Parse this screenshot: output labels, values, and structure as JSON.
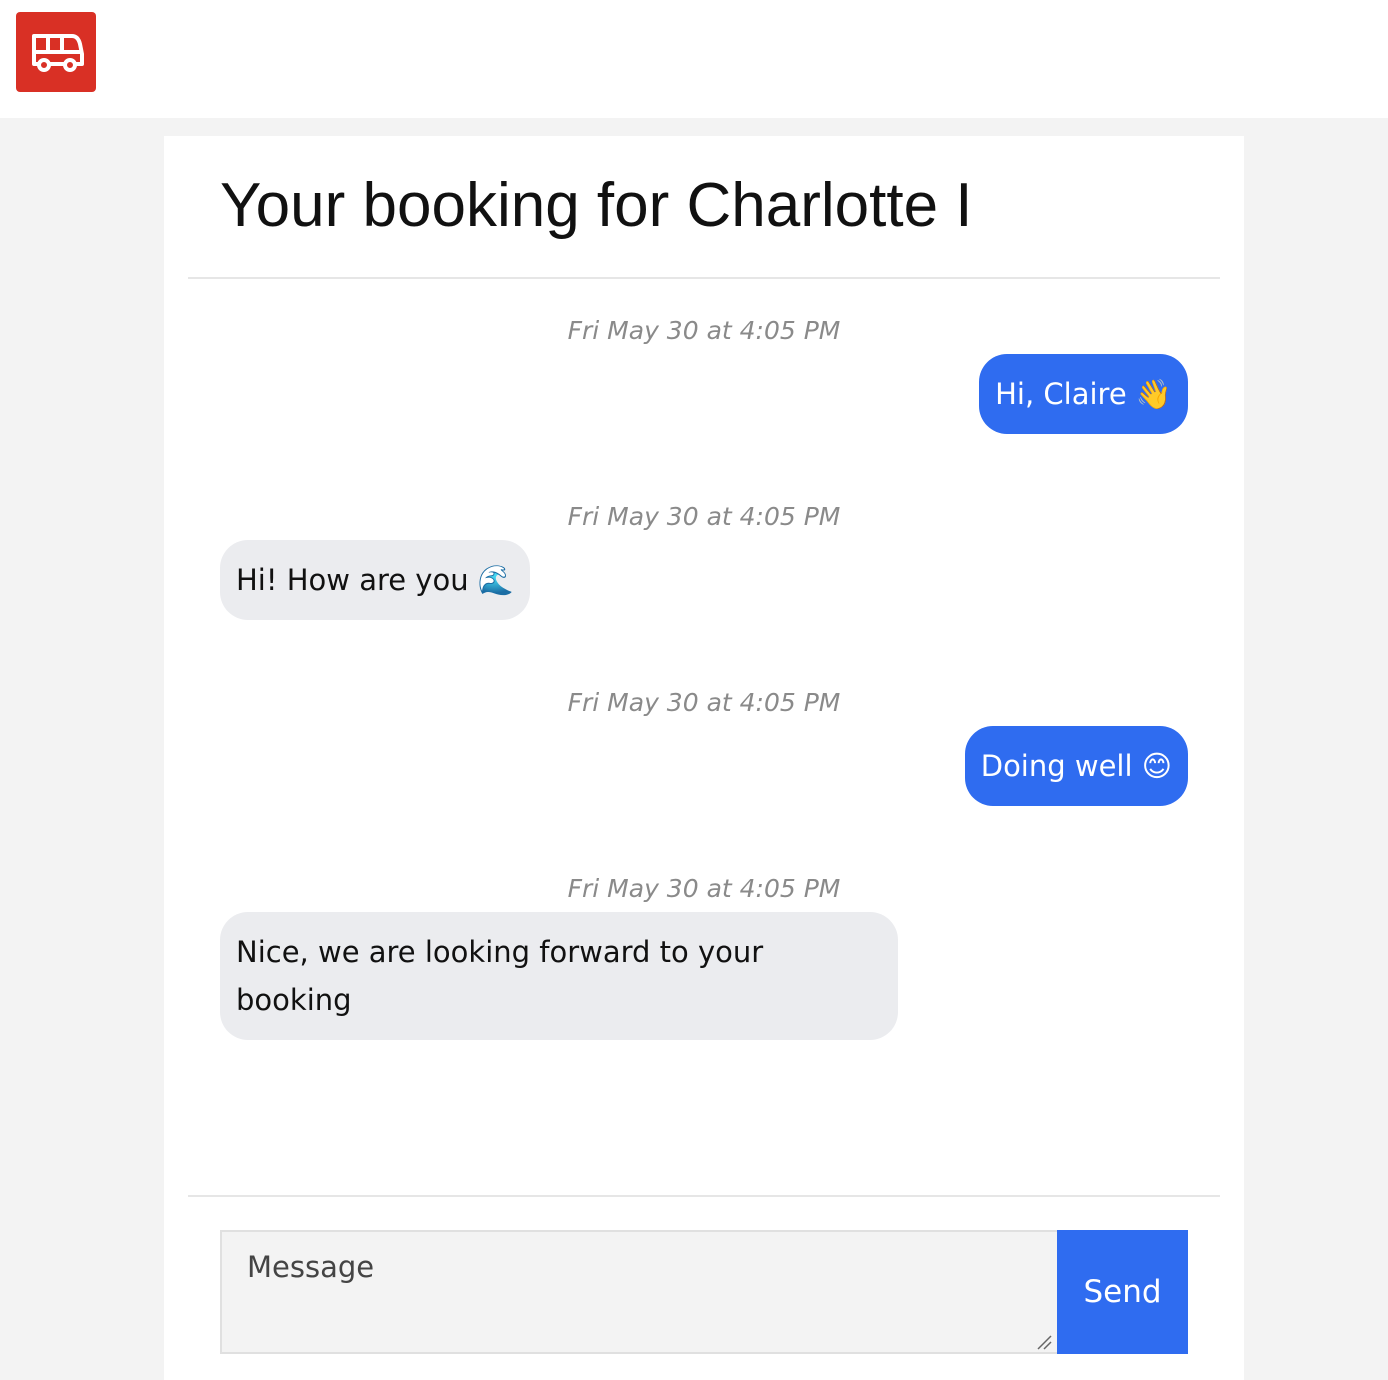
{
  "header": {
    "logo_icon": "van-icon",
    "brand_color": "#d93025"
  },
  "page": {
    "title": "Your booking for Charlotte I"
  },
  "messages": [
    {
      "timestamp": "Fri May 30 at 4:05 PM",
      "text": "Hi, Claire 👋",
      "direction": "outgoing"
    },
    {
      "timestamp": "Fri May 30 at 4:05 PM",
      "text": "Hi! How are you 🌊",
      "direction": "incoming"
    },
    {
      "timestamp": "Fri May 30 at 4:05 PM",
      "text": "Doing well 😊",
      "direction": "outgoing"
    },
    {
      "timestamp": "Fri May 30 at 4:05 PM",
      "text": "Nice, we are looking forward to your booking",
      "direction": "incoming"
    }
  ],
  "composer": {
    "placeholder": "Message",
    "value": "",
    "send_label": "Send"
  },
  "colors": {
    "accent": "#2f6cf0",
    "incoming_bubble": "#ebecef",
    "timestamp": "#8a8a8a"
  }
}
